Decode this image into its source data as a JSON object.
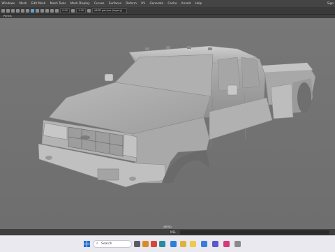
{
  "menubar": {
    "items": [
      "Windows",
      "Mesh",
      "Edit Mesh",
      "Mesh Tools",
      "Mesh Display",
      "Curves",
      "Surfaces",
      "Deform",
      "UV",
      "Generate",
      "Cache",
      "Arnold",
      "Help"
    ],
    "right_hint": "Sign"
  },
  "toolbar": {
    "field1": "0.00",
    "field2": "1.00",
    "field3": "sRGB gamma (legacy)"
  },
  "panels": {
    "label": "Panels"
  },
  "viewport": {
    "camera_label": "persp"
  },
  "statusbar": {
    "mel_label": "MEL"
  },
  "taskbar": {
    "search_placeholder": "Search",
    "time": "",
    "apps": [
      {
        "name": "taskview-icon",
        "color": "#5a5a6a"
      },
      {
        "name": "widget-icon",
        "color": "#d98a2b"
      },
      {
        "name": "app-red-icon",
        "color": "#d4473a"
      },
      {
        "name": "maya-icon",
        "color": "#2a8aa0"
      },
      {
        "name": "edge-icon",
        "color": "#2f7fd8"
      },
      {
        "name": "chrome-icon",
        "color": "#e0b23a"
      },
      {
        "name": "file-explorer-icon",
        "color": "#f0c84a"
      },
      {
        "name": "store-icon",
        "color": "#3c7be0"
      },
      {
        "name": "photos-icon",
        "color": "#5a5acb"
      },
      {
        "name": "instagram-icon",
        "color": "#d43a7a"
      },
      {
        "name": "settings-icon",
        "color": "#8a8a8a"
      }
    ]
  }
}
